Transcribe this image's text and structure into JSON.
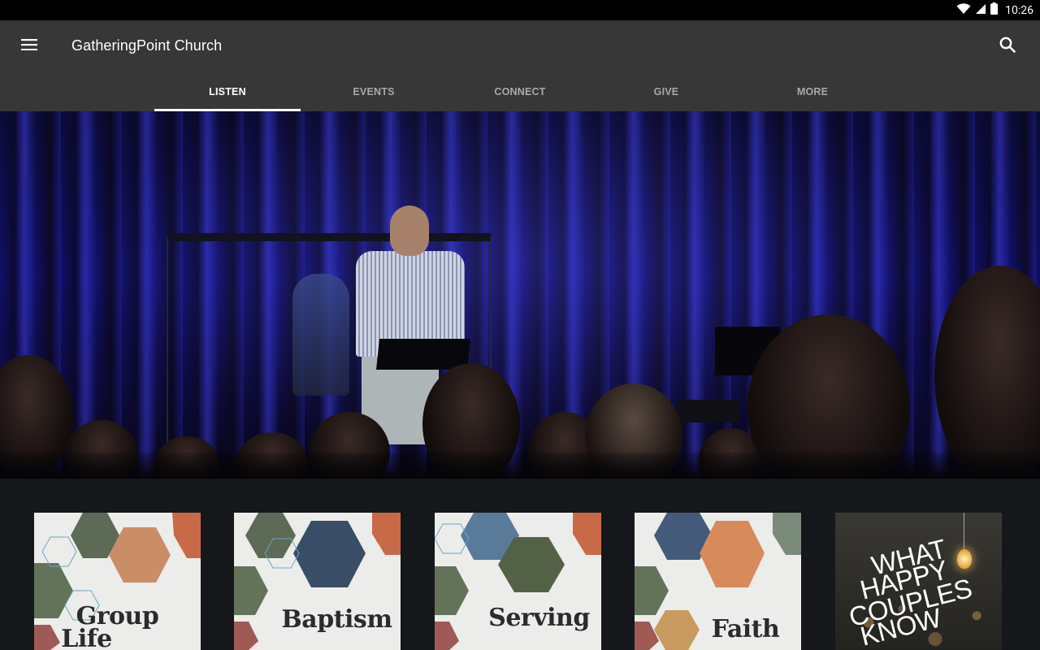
{
  "status_bar": {
    "time": "10:26",
    "icons": [
      "wifi-icon",
      "cellular-icon",
      "battery-icon"
    ]
  },
  "app_bar": {
    "title": "GatheringPoint Church",
    "menu_icon": "hamburger-menu-icon",
    "search_icon": "search-icon"
  },
  "tabs": [
    {
      "label": "LISTEN",
      "active": true
    },
    {
      "label": "EVENTS",
      "active": false
    },
    {
      "label": "CONNECT",
      "active": false
    },
    {
      "label": "GIVE",
      "active": false
    },
    {
      "label": "MORE",
      "active": false
    }
  ],
  "hero": {
    "description_icon": "sermon-stage-photo"
  },
  "cards": [
    {
      "title_line1": "Group",
      "title_line2": "Life"
    },
    {
      "title_line1": "Baptism",
      "title_line2": ""
    },
    {
      "title_line1": "Serving",
      "title_line2": ""
    },
    {
      "title_line1": "Faith",
      "title_line2": ""
    },
    {
      "title_line1": "WHAT",
      "title_line2": "HAPPY",
      "title_line3": "COUPLES",
      "title_line4": "KNOW"
    }
  ],
  "colors": {
    "status_bar": "#000000",
    "app_bar": "#373737",
    "tab_inactive": "#a9a9a9",
    "tab_active": "#ffffff",
    "background": "#16171a"
  }
}
